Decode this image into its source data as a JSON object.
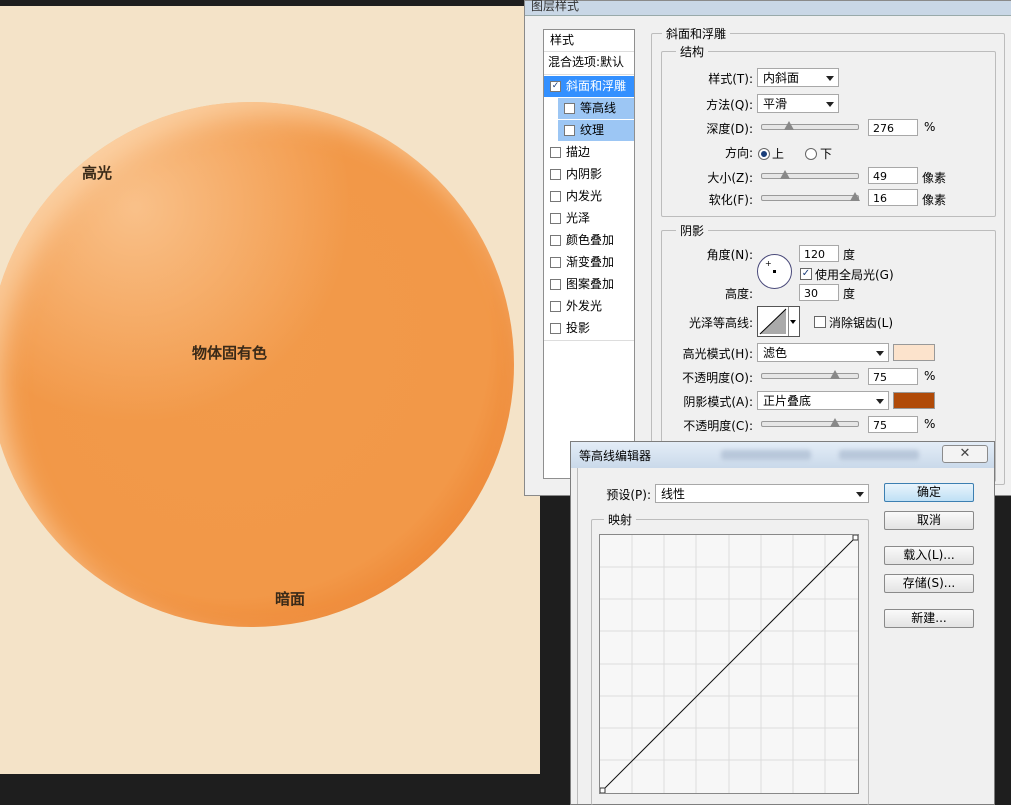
{
  "canvas": {
    "label_highlight": "高光",
    "label_base_color": "物体固有色",
    "label_shadow": "暗面"
  },
  "layer_style": {
    "title": "图层样式",
    "styles_header": "样式",
    "blend_options": "混合选项:默认",
    "items": [
      {
        "label": "斜面和浮雕",
        "checked": true
      },
      {
        "label": "等高线",
        "checked": false
      },
      {
        "label": "纹理",
        "checked": false
      },
      {
        "label": "描边",
        "checked": false
      },
      {
        "label": "内阴影",
        "checked": false
      },
      {
        "label": "内发光",
        "checked": false
      },
      {
        "label": "光泽",
        "checked": false
      },
      {
        "label": "颜色叠加",
        "checked": false
      },
      {
        "label": "渐变叠加",
        "checked": false
      },
      {
        "label": "图案叠加",
        "checked": false
      },
      {
        "label": "外发光",
        "checked": false
      },
      {
        "label": "投影",
        "checked": false
      }
    ],
    "bevel": {
      "section_title": "斜面和浮雕",
      "structure_title": "结构",
      "style_label": "样式(T):",
      "style_value": "内斜面",
      "technique_label": "方法(Q):",
      "technique_value": "平滑",
      "depth_label": "深度(D):",
      "depth_value": "276",
      "depth_unit": "%",
      "direction_label": "方向:",
      "direction_up": "上",
      "direction_down": "下",
      "size_label": "大小(Z):",
      "size_value": "49",
      "size_unit": "像素",
      "soften_label": "软化(F):",
      "soften_value": "16",
      "soften_unit": "像素"
    },
    "shading": {
      "title": "阴影",
      "angle_label": "角度(N):",
      "angle_value": "120",
      "angle_unit": "度",
      "global_light_label": "使用全局光(G)",
      "global_light_checked": true,
      "altitude_label": "高度:",
      "altitude_value": "30",
      "altitude_unit": "度",
      "gloss_contour_label": "光泽等高线:",
      "anti_alias_label": "消除锯齿(L)",
      "highlight_mode_label": "高光模式(H):",
      "highlight_mode_value": "滤色",
      "highlight_color": "#fce3cc",
      "highlight_opacity_label": "不透明度(O):",
      "highlight_opacity_value": "75",
      "highlight_opacity_unit": "%",
      "shadow_mode_label": "阴影模式(A):",
      "shadow_mode_value": "正片叠底",
      "shadow_color": "#b04a08",
      "shadow_opacity_label": "不透明度(C):",
      "shadow_opacity_value": "75",
      "shadow_opacity_unit": "%"
    }
  },
  "contour_editor": {
    "title": "等高线编辑器",
    "close_icon": "close-icon",
    "preset_label": "预设(P):",
    "preset_value": "线性",
    "mapping_title": "映射",
    "buttons": {
      "ok": "确定",
      "cancel": "取消",
      "load": "载入(L)...",
      "save": "存储(S)...",
      "new": "新建..."
    }
  }
}
